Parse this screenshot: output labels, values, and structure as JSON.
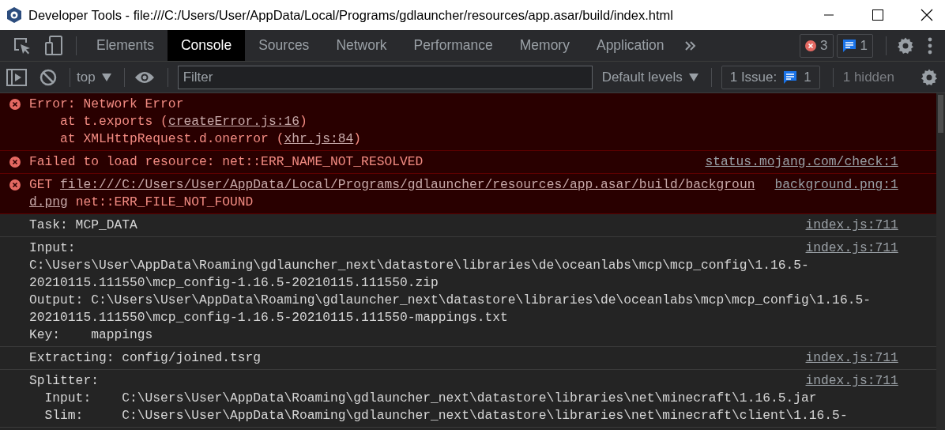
{
  "window": {
    "title": "Developer Tools - file:///C:/Users/User/AppData/Local/Programs/gdlauncher/resources/app.asar/build/index.html"
  },
  "tabs": [
    {
      "label": "Elements",
      "selected": false
    },
    {
      "label": "Console",
      "selected": true
    },
    {
      "label": "Sources",
      "selected": false
    },
    {
      "label": "Network",
      "selected": false
    },
    {
      "label": "Performance",
      "selected": false
    },
    {
      "label": "Memory",
      "selected": false
    },
    {
      "label": "Application",
      "selected": false
    }
  ],
  "counters": {
    "errors": "3",
    "messages": "1"
  },
  "console_toolbar": {
    "context": "top",
    "filter": {
      "placeholder": "Filter"
    },
    "levels": "Default levels",
    "issues_label": "1 Issue:",
    "issues_count": "1",
    "hidden": "1 hidden"
  },
  "messages": [
    {
      "kind": "error",
      "lines": [
        [
          {
            "text": "Error: Network Error",
            "kind": "text"
          }
        ],
        [
          {
            "text": "    at t.exports (",
            "kind": "text"
          },
          {
            "text": "createError.js:16",
            "kind": "link"
          },
          {
            "text": ")",
            "kind": "text"
          }
        ],
        [
          {
            "text": "    at XMLHttpRequest.d.onerror (",
            "kind": "text"
          },
          {
            "text": "xhr.js:84",
            "kind": "link"
          },
          {
            "text": ")",
            "kind": "text"
          }
        ]
      ]
    },
    {
      "kind": "error",
      "source": "status.mojang.com/check:1",
      "lines": [
        [
          {
            "text": "Failed to load resource: net::ERR_NAME_NOT_RESOLVED",
            "kind": "text"
          }
        ]
      ]
    },
    {
      "kind": "error",
      "source": "background.png:1",
      "lines": [
        [
          {
            "text": "GET ",
            "kind": "text"
          },
          {
            "text": "file:///C:/Users/User/AppData/Local/Programs/gdlauncher/resources/app.asar/build/backgroun",
            "kind": "link"
          }
        ],
        [
          {
            "text": "d.png",
            "kind": "link"
          },
          {
            "text": " net::ERR_FILE_NOT_FOUND",
            "kind": "text"
          }
        ]
      ]
    },
    {
      "kind": "log",
      "source": "index.js:711",
      "lines": [
        [
          {
            "text": "Task: MCP_DATA",
            "kind": "text"
          }
        ]
      ]
    },
    {
      "kind": "log",
      "source": "index.js:711",
      "lines": [
        [
          {
            "text": "Input:",
            "kind": "text"
          }
        ],
        [
          {
            "text": "C:\\Users\\User\\AppData\\Roaming\\gdlauncher_next\\datastore\\libraries\\de\\oceanlabs\\mcp\\mcp_config\\1.16.5-",
            "kind": "text"
          }
        ],
        [
          {
            "text": "20210115.111550\\mcp_config-1.16.5-20210115.111550.zip",
            "kind": "text"
          }
        ],
        [
          {
            "text": "Output: C:\\Users\\User\\AppData\\Roaming\\gdlauncher_next\\datastore\\libraries\\de\\oceanlabs\\mcp\\mcp_config\\1.16.5-",
            "kind": "text"
          }
        ],
        [
          {
            "text": "20210115.111550\\mcp_config-1.16.5-20210115.111550-mappings.txt",
            "kind": "text"
          }
        ],
        [
          {
            "text": "Key:    mappings",
            "kind": "text"
          }
        ]
      ]
    },
    {
      "kind": "log",
      "source": "index.js:711",
      "lines": [
        [
          {
            "text": "Extracting: config/joined.tsrg",
            "kind": "text"
          }
        ]
      ]
    },
    {
      "kind": "log",
      "source": "index.js:711",
      "lines": [
        [
          {
            "text": "Splitter:",
            "kind": "text"
          }
        ],
        [
          {
            "text": "  Input:    C:\\Users\\User\\AppData\\Roaming\\gdlauncher_next\\datastore\\libraries\\net\\minecraft\\1.16.5.jar",
            "kind": "text"
          }
        ],
        [
          {
            "text": "  Slim:     C:\\Users\\User\\AppData\\Roaming\\gdlauncher_next\\datastore\\libraries\\net\\minecraft\\client\\1.16.5-",
            "kind": "text"
          }
        ]
      ]
    }
  ]
}
